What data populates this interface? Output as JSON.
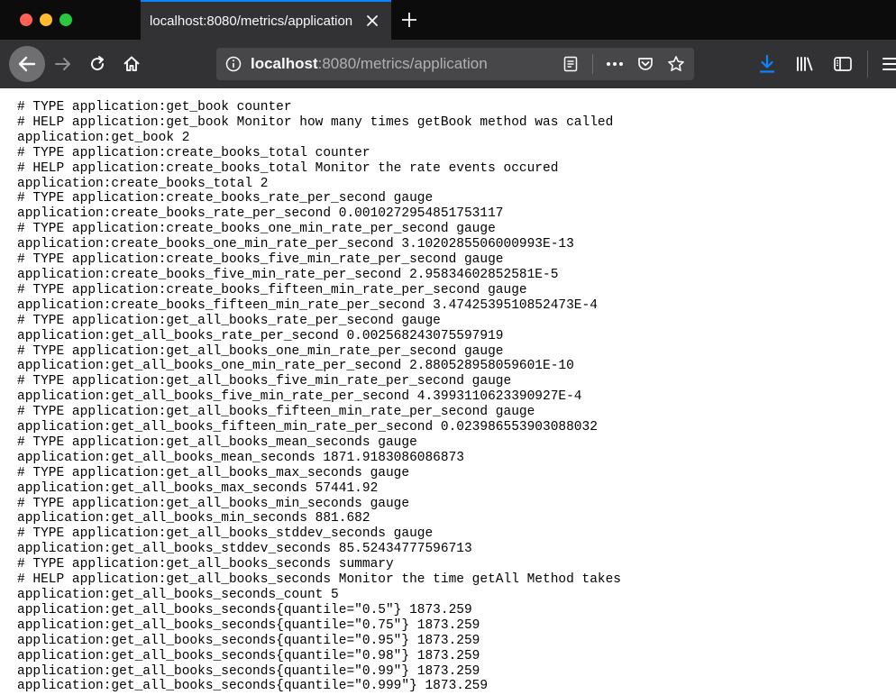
{
  "browser": {
    "tab": {
      "title": "localhost:8080/metrics/application"
    },
    "url": {
      "host": "localhost",
      "rest": ":8080/metrics/application"
    },
    "icons": {
      "close": "close-icon",
      "new_tab": "plus-icon",
      "back": "arrow-left-icon",
      "forward": "arrow-right-icon",
      "reload": "reload-icon",
      "home": "home-icon",
      "info": "info-icon",
      "reader": "reader-view-icon",
      "page_actions": "more-icon",
      "pocket": "pocket-icon",
      "bookmark": "star-icon",
      "downloads": "download-icon",
      "library": "library-icon",
      "sidebar": "sidebar-icon",
      "menu": "hamburger-menu-icon"
    },
    "colors": {
      "download_accent": "#0a84ff",
      "tab_highlight": "#0a84ff"
    }
  },
  "metrics": [
    "# TYPE application:get_book counter",
    "# HELP application:get_book Monitor how many times getBook method was called",
    "application:get_book 2",
    "# TYPE application:create_books_total counter",
    "# HELP application:create_books_total Monitor the rate events occured",
    "application:create_books_total 2",
    "# TYPE application:create_books_rate_per_second gauge",
    "application:create_books_rate_per_second 0.0010272954851753117",
    "# TYPE application:create_books_one_min_rate_per_second gauge",
    "application:create_books_one_min_rate_per_second 3.1020285506000993E-13",
    "# TYPE application:create_books_five_min_rate_per_second gauge",
    "application:create_books_five_min_rate_per_second 2.95834602852581E-5",
    "# TYPE application:create_books_fifteen_min_rate_per_second gauge",
    "application:create_books_fifteen_min_rate_per_second 3.4742539510852473E-4",
    "# TYPE application:get_all_books_rate_per_second gauge",
    "application:get_all_books_rate_per_second 0.002568243075597919",
    "# TYPE application:get_all_books_one_min_rate_per_second gauge",
    "application:get_all_books_one_min_rate_per_second 2.880528958059601E-10",
    "# TYPE application:get_all_books_five_min_rate_per_second gauge",
    "application:get_all_books_five_min_rate_per_second 4.3993110623390927E-4",
    "# TYPE application:get_all_books_fifteen_min_rate_per_second gauge",
    "application:get_all_books_fifteen_min_rate_per_second 0.023986553903088032",
    "# TYPE application:get_all_books_mean_seconds gauge",
    "application:get_all_books_mean_seconds 1871.9183086086873",
    "# TYPE application:get_all_books_max_seconds gauge",
    "application:get_all_books_max_seconds 57441.92",
    "# TYPE application:get_all_books_min_seconds gauge",
    "application:get_all_books_min_seconds 881.682",
    "# TYPE application:get_all_books_stddev_seconds gauge",
    "application:get_all_books_stddev_seconds 85.52434777596713",
    "# TYPE application:get_all_books_seconds summary",
    "# HELP application:get_all_books_seconds Monitor the time getAll Method takes",
    "application:get_all_books_seconds_count 5",
    "application:get_all_books_seconds{quantile=\"0.5\"} 1873.259",
    "application:get_all_books_seconds{quantile=\"0.75\"} 1873.259",
    "application:get_all_books_seconds{quantile=\"0.95\"} 1873.259",
    "application:get_all_books_seconds{quantile=\"0.98\"} 1873.259",
    "application:get_all_books_seconds{quantile=\"0.99\"} 1873.259",
    "application:get_all_books_seconds{quantile=\"0.999\"} 1873.259"
  ]
}
